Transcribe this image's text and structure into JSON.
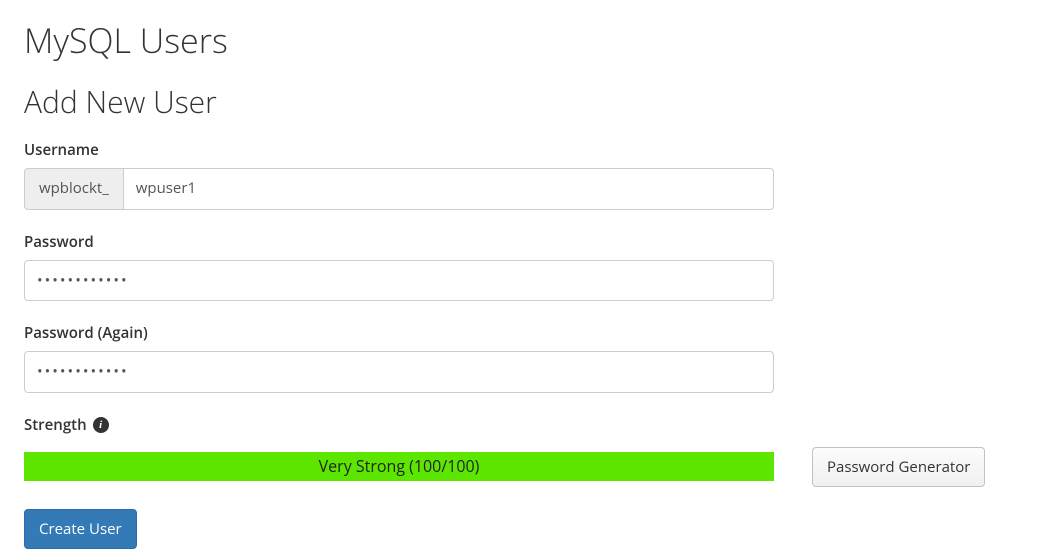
{
  "page": {
    "title": "MySQL Users",
    "subtitle": "Add New User"
  },
  "form": {
    "username": {
      "label": "Username",
      "prefix": "wpblockt_",
      "value": "wpuser1"
    },
    "password": {
      "label": "Password",
      "value": "••••••••••••"
    },
    "password_again": {
      "label": "Password (Again)",
      "value": "••••••••••••"
    },
    "strength": {
      "label": "Strength",
      "text": "Very Strong (100/100)",
      "color": "#5ce600",
      "score": 100
    },
    "buttons": {
      "password_generator": "Password Generator",
      "create": "Create User"
    }
  }
}
